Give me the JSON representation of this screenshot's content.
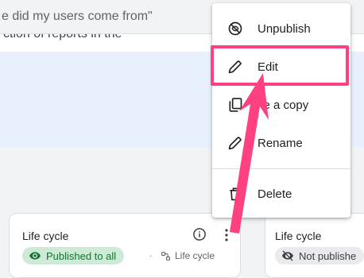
{
  "search": {
    "value": "e did my users come from\""
  },
  "description": {
    "text": "ction of reports in the"
  },
  "cards": [
    {
      "title": "Life cycle",
      "status": "Published to all",
      "link_label": "Life cycle",
      "separator": "·"
    },
    {
      "title": "Life cycle",
      "status": "Not publishe"
    }
  ],
  "menu": {
    "items": [
      {
        "label": "Unpublish",
        "icon": "unpublish-icon"
      },
      {
        "label": "Edit",
        "icon": "pencil-icon"
      },
      {
        "label": "ke a copy",
        "icon": "copy-icon"
      },
      {
        "label": "Rename",
        "icon": "pencil-icon"
      },
      {
        "label": "Delete",
        "icon": "trash-icon"
      }
    ]
  },
  "colors": {
    "highlight": "#ff4081",
    "published_chip_bg": "#ceead6",
    "published_chip_text": "#137333",
    "banner": "#e8f0fe"
  }
}
